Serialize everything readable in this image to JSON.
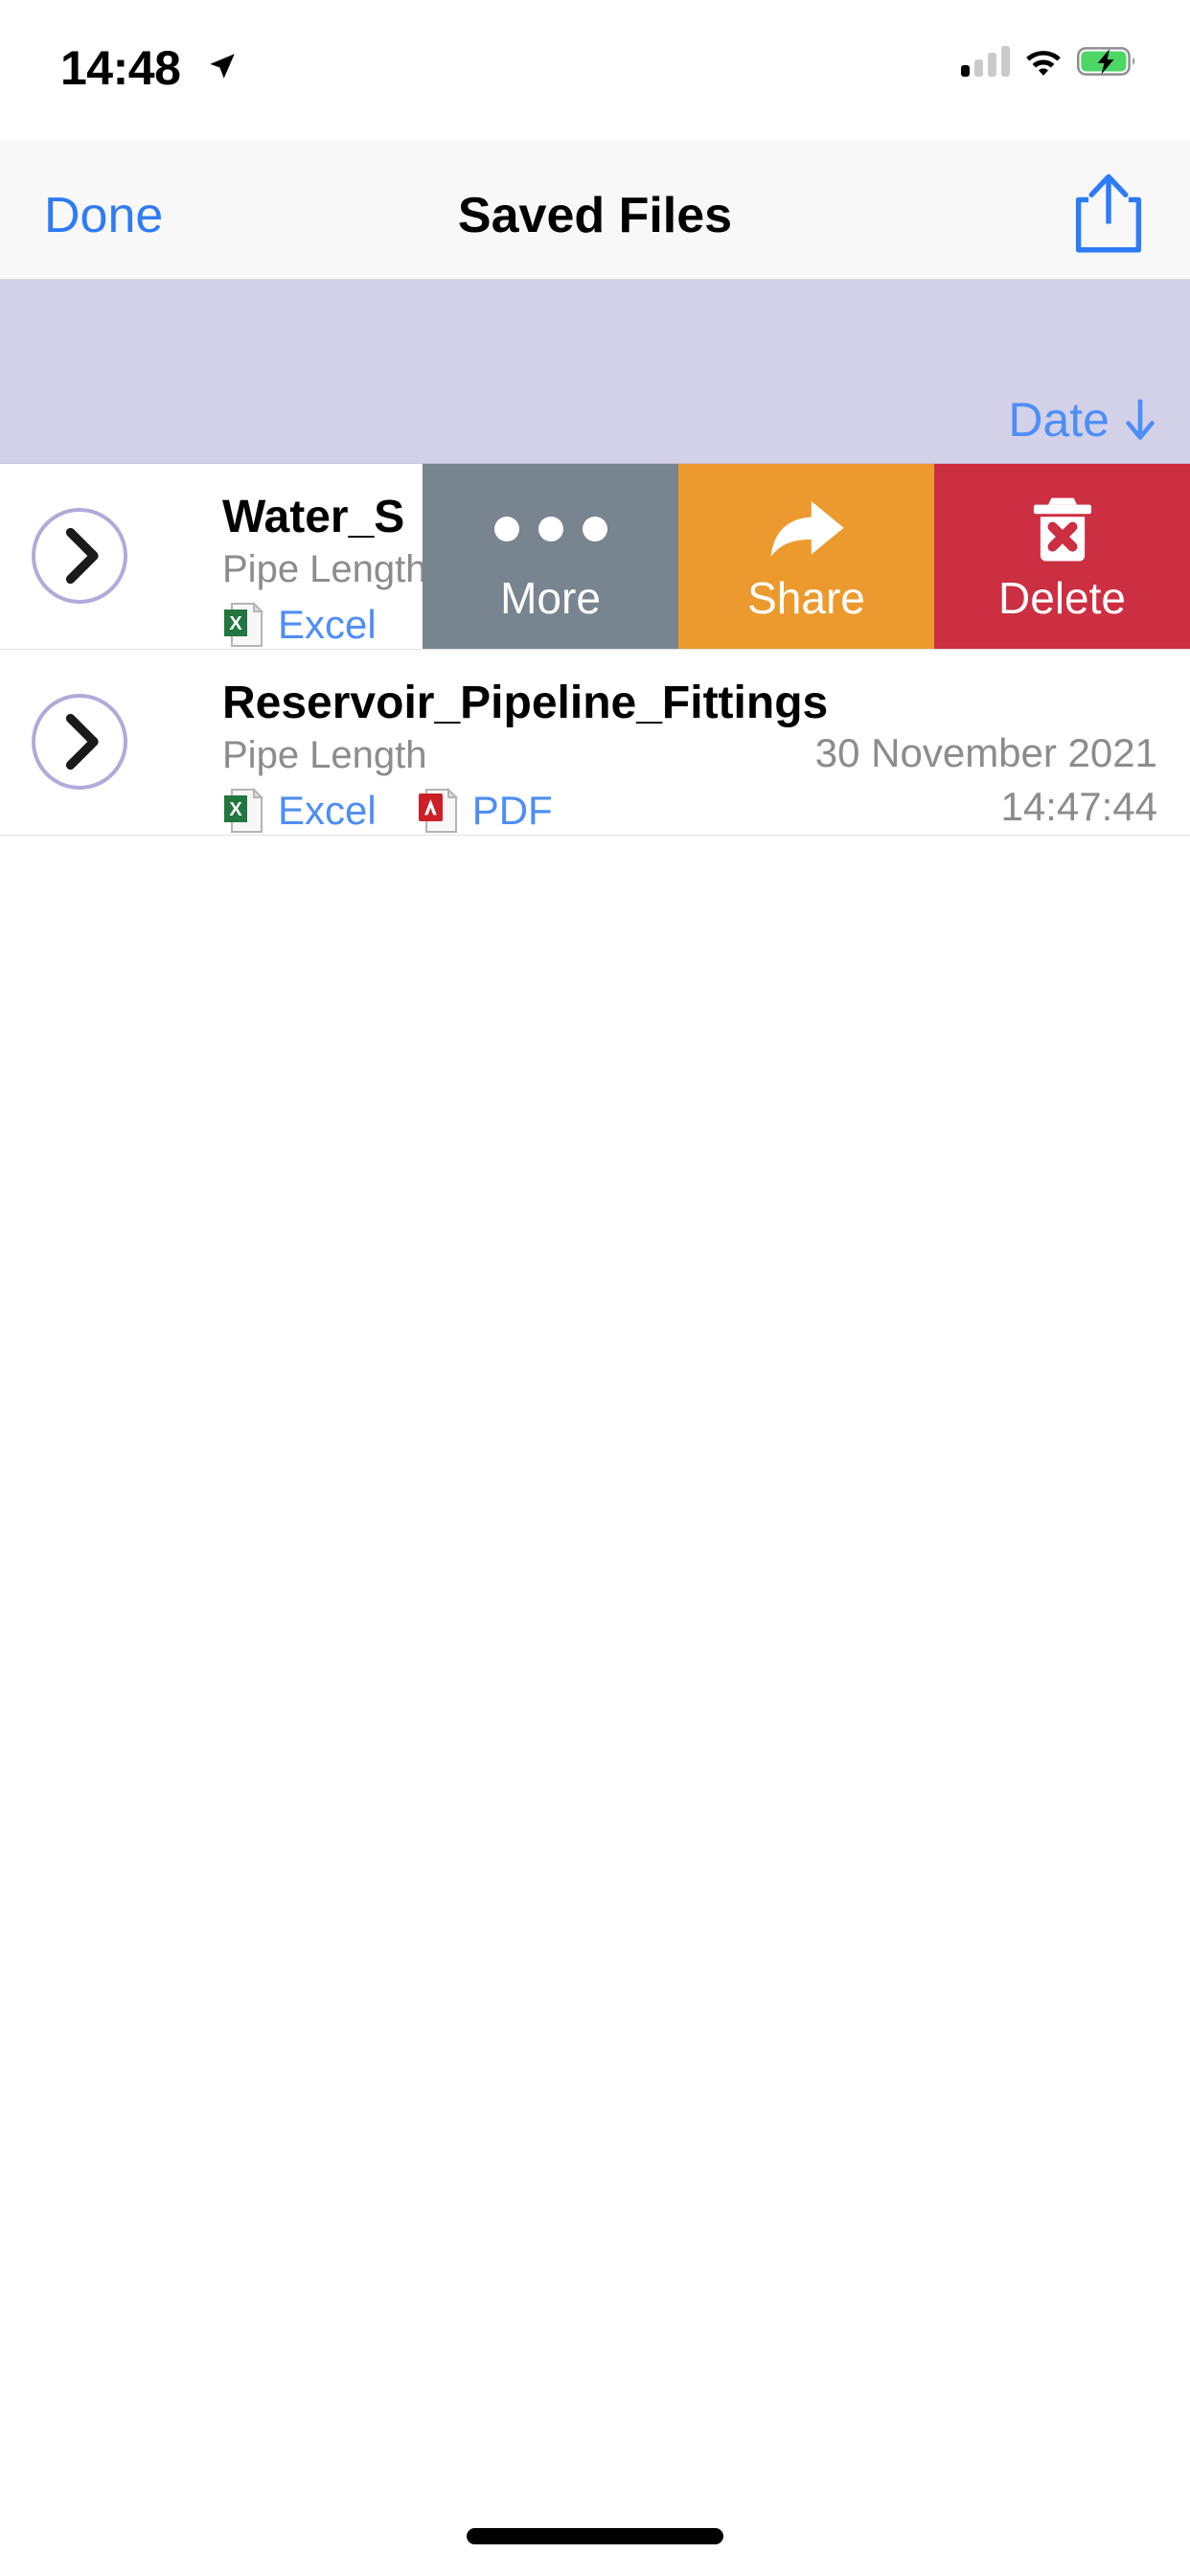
{
  "status_bar": {
    "time": "14:48",
    "location_icon": "location-arrow-icon",
    "signal_icon": "cellular-signal-icon",
    "signal_bars_active": 1,
    "signal_bars_total": 4,
    "wifi_icon": "wifi-icon",
    "battery_icon": "battery-charging-icon",
    "battery_color": "#4cd663"
  },
  "nav_bar": {
    "done_label": "Done",
    "title": "Saved Files",
    "share_icon": "share-up-arrow-icon",
    "accent_color": "#2d7cf6"
  },
  "sort_bar": {
    "label": "Date",
    "arrow_icon": "arrow-down-icon",
    "direction": "descending",
    "background_color": "#d3d1e8",
    "text_color": "#4d8ef7"
  },
  "files": [
    {
      "name": "Water_S",
      "subtitle": "Pipe Length",
      "date": "",
      "time": "",
      "attachments": [
        {
          "label": "Excel",
          "icon": "excel-file-icon"
        }
      ],
      "swiped": true,
      "disclosure_icon": "chevron-right-icon"
    },
    {
      "name": "Reservoir_Pipeline_Fittings",
      "subtitle": "Pipe Length",
      "date": "30 November 2021",
      "time": "14:47:44",
      "attachments": [
        {
          "label": "Excel",
          "icon": "excel-file-icon"
        },
        {
          "label": "PDF",
          "icon": "pdf-file-icon"
        }
      ],
      "swiped": false,
      "disclosure_icon": "chevron-right-icon"
    }
  ],
  "swipe_actions": [
    {
      "label": "More",
      "icon": "ellipsis-icon",
      "color": "#78848f"
    },
    {
      "label": "Share",
      "icon": "share-arrow-icon",
      "color": "#ec9a2e"
    },
    {
      "label": "Delete",
      "icon": "trash-x-icon",
      "color": "#cc2e42"
    }
  ],
  "home_indicator": "home-indicator"
}
